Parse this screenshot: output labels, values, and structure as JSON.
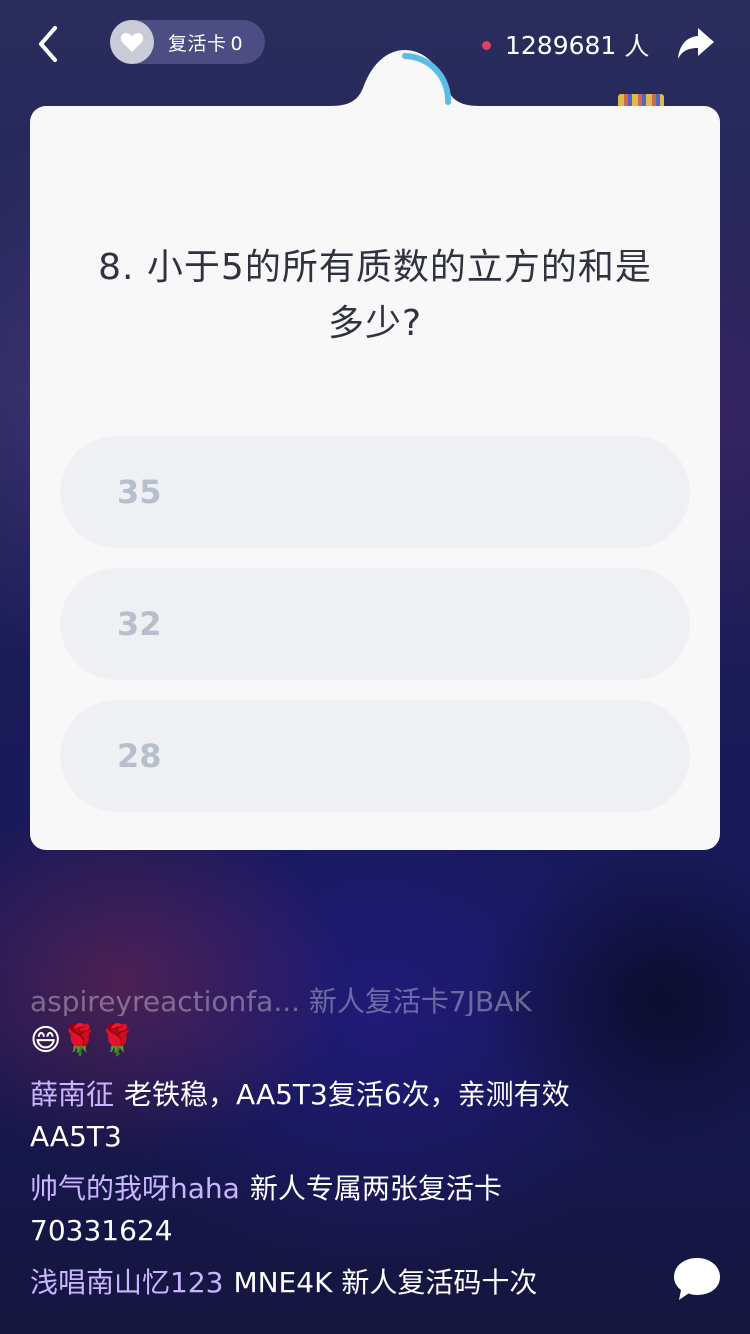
{
  "topbar": {
    "revive_label": "复活卡",
    "revive_count": "0",
    "viewer_count": "1289681",
    "viewer_unit": "人"
  },
  "question": {
    "text": "8. 小于5的所有质数的立方的和是多少?"
  },
  "options": [
    {
      "label": "35"
    },
    {
      "label": "32"
    },
    {
      "label": "28"
    }
  ],
  "chat": {
    "faded_line": "aspireyreactionfa... 新人复活卡7JBAK",
    "emoji_line": "😄🌹🌹",
    "messages": [
      {
        "user": "薛南征",
        "text": "老铁稳，AA5T3复活6次，亲测有效AA5T3"
      },
      {
        "user": "帅气的我呀haha",
        "text": "新人专属两张复活卡 70331624"
      },
      {
        "user": "浅唱南山忆123",
        "text": "MNE4K 新人复活码十次"
      }
    ]
  },
  "colors": {
    "accent_timer": "#5bbde6",
    "live_dot": "#e63b62",
    "username": "#c9b5ff"
  }
}
